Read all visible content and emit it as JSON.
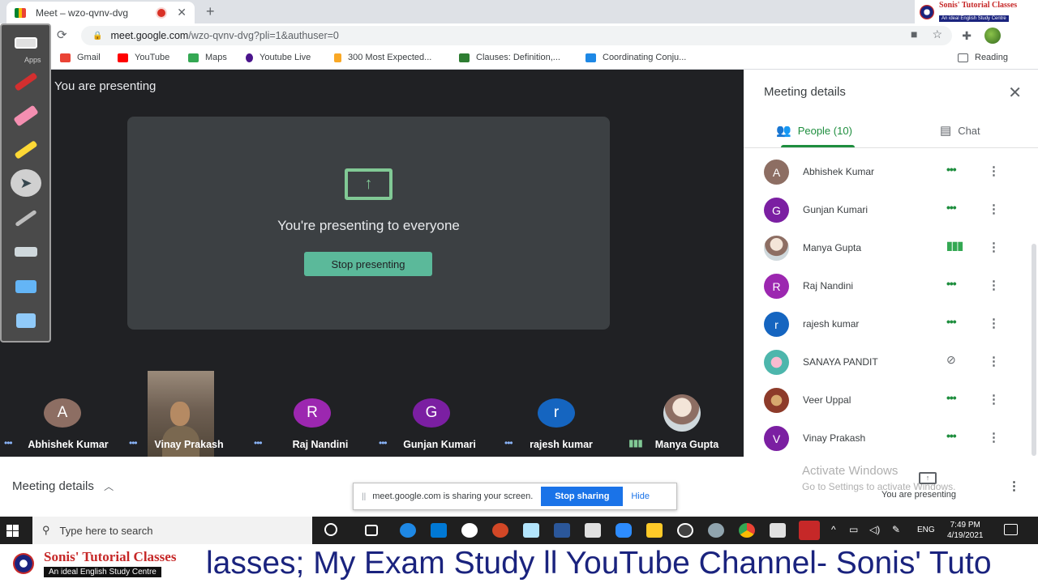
{
  "browser": {
    "tab_title": "Meet – wzo-qvnv-dvg",
    "tab_close": "✕",
    "new_tab": "+",
    "url_host": "meet.google.com",
    "url_path": "/wzo-qvnv-dvg?pli=1&authuser=0",
    "reading_list": "Reading"
  },
  "bookmarks": [
    {
      "label": "Gmail",
      "color": "#ea4335"
    },
    {
      "label": "YouTube",
      "color": "#ff0000"
    },
    {
      "label": "Maps",
      "color": "#34a853"
    },
    {
      "label": "Youtube Live",
      "color": "#4a148c"
    },
    {
      "label": "300 Most Expected...",
      "color": "#f9a825"
    },
    {
      "label": "Clauses: Definition,...",
      "color": "#2e7d32"
    },
    {
      "label": "Coordinating Conju...",
      "color": "#1e88e5"
    }
  ],
  "pen_toolbar": {
    "apps_label": "Apps"
  },
  "brand": {
    "name": "Sonis' Tutorial Classes",
    "tagline": "An ideal English Study Centre"
  },
  "stage": {
    "presenting_label": "You are presenting",
    "card_title": "You're presenting to everyone",
    "stop_presenting": "Stop presenting"
  },
  "tiles": [
    {
      "name": "Abhishek Kumar",
      "initial": "A",
      "color": "#8d6e63"
    },
    {
      "name": "Vinay Prakash",
      "initial": "",
      "color": ""
    },
    {
      "name": "Raj Nandini",
      "initial": "R",
      "color": "#9c27b0"
    },
    {
      "name": "Gunjan Kumari",
      "initial": "G",
      "color": "#7b1fa2"
    },
    {
      "name": "rajesh kumar",
      "initial": "r",
      "color": "#1565c0"
    },
    {
      "name": "Manya Gupta",
      "initial": "",
      "color": ""
    }
  ],
  "bottom_bar": {
    "meeting_details": "Meeting details",
    "share_notice": "meet.google.com is sharing your screen.",
    "stop_sharing": "Stop sharing",
    "hide": "Hide"
  },
  "panel": {
    "title": "Meeting details",
    "people_tab": "People (10)",
    "chat_tab": "Chat",
    "people": [
      {
        "name": "Abhishek Kumar",
        "initial": "A",
        "color": "#8d6e63",
        "status": "dots"
      },
      {
        "name": "Gunjan Kumari",
        "initial": "G",
        "color": "#7b1fa2",
        "status": "dots"
      },
      {
        "name": "Manya Gupta",
        "initial": "",
        "color": "#bcaaa4",
        "status": "speaking"
      },
      {
        "name": "Raj Nandini",
        "initial": "R",
        "color": "#9c27b0",
        "status": "dots"
      },
      {
        "name": "rajesh kumar",
        "initial": "r",
        "color": "#1565c0",
        "status": "dots"
      },
      {
        "name": "SANAYA PANDIT",
        "initial": "",
        "color": "#80cbc4",
        "status": "muted"
      },
      {
        "name": "Veer Uppal",
        "initial": "",
        "color": "#a1887f",
        "status": "dots"
      },
      {
        "name": "Vinay Prakash",
        "initial": "V",
        "color": "#7b1fa2",
        "status": "dots"
      }
    ],
    "activate_title": "Activate Windows",
    "activate_sub": "Go to Settings to activate Windows.",
    "you_are_presenting": "You are presenting"
  },
  "taskbar": {
    "search_placeholder": "Type here to search",
    "language": "ENG",
    "time": "7:49 PM",
    "date": "4/19/2021"
  },
  "ticker": {
    "text": "lasses; My Exam Study ll YouTube Channel- Sonis' Tuto"
  }
}
